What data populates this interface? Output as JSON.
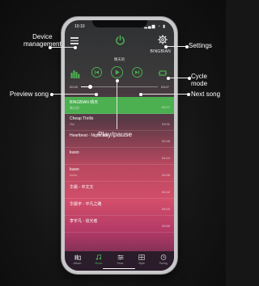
{
  "callouts": {
    "device_management": "Device\nmanagement",
    "settings": "Settings",
    "cycle_mode": "Cycle\nmode",
    "preview_song": "Preview song",
    "next_song": "Next song",
    "play_pause": "Play/pause"
  },
  "status_bar": {
    "time": "10:10",
    "icons": "▂▄▆ ◔ ▮"
  },
  "device": {
    "name": "BINGBIAN"
  },
  "now_playing": {
    "title": "晴天的"
  },
  "player": {
    "elapsed": "00:00",
    "total": "03:07",
    "progress": 0.12
  },
  "playlist": [
    {
      "title": "BINGBIAN 晴天",
      "subtitle": "晴天的",
      "duration": "04:07",
      "active": true
    },
    {
      "title": "Cheap Thrills",
      "subtitle": "Sia",
      "duration": "03:31",
      "active": false
    },
    {
      "title": "Heartbeat - Nightcore",
      "subtitle": "",
      "duration": "02:46",
      "active": false
    },
    {
      "title": "kuwo",
      "subtitle": "",
      "duration": "04:19",
      "active": false
    },
    {
      "title": "kuwo",
      "subtitle": "kuwo",
      "duration": "03:45",
      "active": false
    },
    {
      "title": "华晨 - 中文文",
      "subtitle": "",
      "duration": "04:42",
      "active": false
    },
    {
      "title": "华晨宇 - 平凡之路",
      "subtitle": "",
      "duration": "04:03",
      "active": false
    },
    {
      "title": "李宇凡 - 追光者",
      "subtitle": "",
      "duration": "03:55",
      "active": false
    }
  ],
  "tabs": [
    {
      "label": "Album",
      "icon": "album-icon",
      "active": false
    },
    {
      "label": "Music",
      "icon": "music-note-icon",
      "active": true
    },
    {
      "label": "Faux",
      "icon": "equalizer-icon",
      "active": false
    },
    {
      "label": "Style",
      "icon": "grid-icon",
      "active": false
    },
    {
      "label": "Timing",
      "icon": "clock-icon",
      "active": false
    }
  ],
  "colors": {
    "accent": "#4caf50",
    "callout_text": "#ffffff"
  }
}
